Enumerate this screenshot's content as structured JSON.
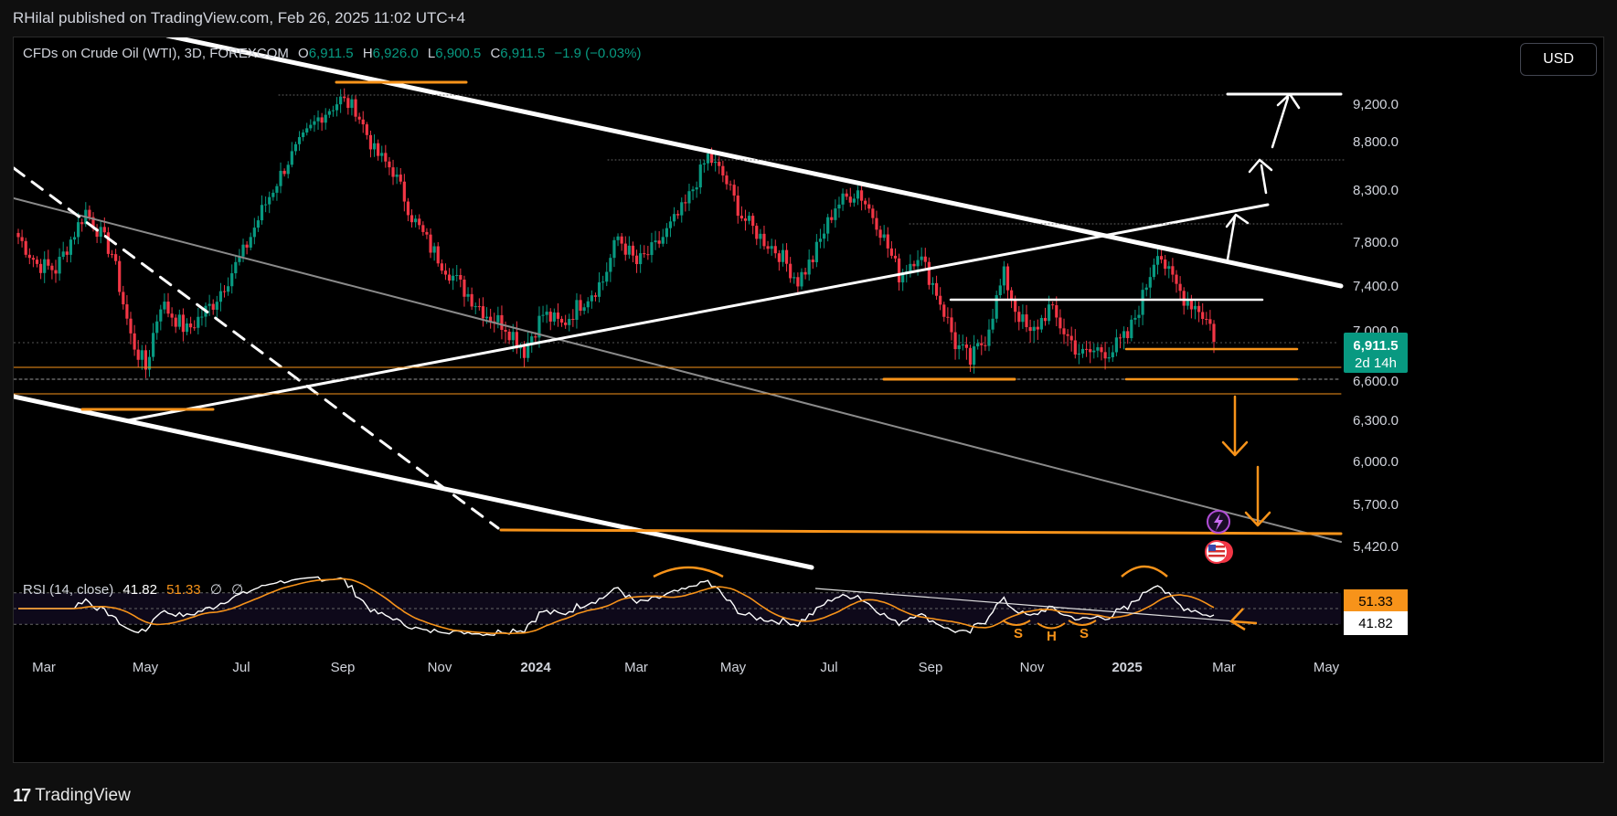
{
  "header": {
    "publish_line": "RHilal published on TradingView.com, Feb 26, 2025 11:02 UTC+4"
  },
  "footer": {
    "logo_mark": "17",
    "logo_text": "TradingView"
  },
  "toolbar": {
    "currency": "USD"
  },
  "legend": {
    "symbol": "CFDs on Crude Oil (WTI), 3D, FOREXCOM",
    "o_label": "O",
    "o_value": "6,911.5",
    "h_label": "H",
    "h_value": "6,926.0",
    "l_label": "L",
    "l_value": "6,900.5",
    "c_label": "C",
    "c_value": "6,911.5",
    "change": "−1.9 (−0.03%)"
  },
  "rsi_legend": {
    "name": "RSI (14, close)",
    "rsi_value": "41.82",
    "ma_value": "51.33",
    "extra1": "∅",
    "extra2": "∅"
  },
  "price_tag": {
    "value": "6,911.5",
    "countdown": "2d 14h"
  },
  "rsi_tags": {
    "ma": "51.33",
    "rsi": "41.82"
  },
  "pattern_labels": [
    "S",
    "H",
    "S"
  ],
  "colors": {
    "up": "#089981",
    "down": "#f23645",
    "orange": "#f7931a",
    "rsi_line": "#ffffff",
    "rsi_ma": "#f7931a",
    "accent_tag": "#089981"
  },
  "chart_data": {
    "type": "candlestick",
    "title": "CFDs on Crude Oil (WTI), 3D, FOREXCOM",
    "price_axis": {
      "ticks": [
        "9,200.0",
        "8,800.0",
        "8,300.0",
        "7,800.0",
        "7,400.0",
        "7,000.0",
        "6,600.0",
        "6,300.0",
        "6,000.0",
        "5,700.0",
        "5,420.0"
      ],
      "tick_values": [
        9200,
        8800,
        8300,
        7800,
        7400,
        7000,
        6600,
        6300,
        6000,
        5700,
        5420
      ]
    },
    "time_axis": {
      "labels": [
        "Mar",
        "May",
        "Jul",
        "Sep",
        "Nov",
        "2024",
        "Mar",
        "May",
        "Jul",
        "Sep",
        "Nov",
        "2025",
        "Mar",
        "May"
      ],
      "bold": [
        false,
        false,
        false,
        false,
        false,
        true,
        false,
        false,
        false,
        false,
        false,
        true,
        false,
        false
      ]
    },
    "close_anchors": [
      [
        0,
        7850
      ],
      [
        5,
        7600
      ],
      [
        10,
        7550
      ],
      [
        18,
        8100
      ],
      [
        25,
        7700
      ],
      [
        30,
        6950
      ],
      [
        34,
        6700
      ],
      [
        38,
        7250
      ],
      [
        45,
        7000
      ],
      [
        52,
        7250
      ],
      [
        60,
        7700
      ],
      [
        65,
        8100
      ],
      [
        72,
        8600
      ],
      [
        80,
        9050
      ],
      [
        86,
        9250
      ],
      [
        90,
        9150
      ],
      [
        95,
        8700
      ],
      [
        100,
        8500
      ],
      [
        105,
        8050
      ],
      [
        110,
        7750
      ],
      [
        118,
        7400
      ],
      [
        125,
        7150
      ],
      [
        130,
        7050
      ],
      [
        135,
        6850
      ],
      [
        140,
        7150
      ],
      [
        145,
        7050
      ],
      [
        150,
        7250
      ],
      [
        156,
        7450
      ],
      [
        160,
        7850
      ],
      [
        165,
        7600
      ],
      [
        170,
        7750
      ],
      [
        178,
        8150
      ],
      [
        184,
        8650
      ],
      [
        188,
        8450
      ],
      [
        193,
        8050
      ],
      [
        198,
        7850
      ],
      [
        203,
        7700
      ],
      [
        208,
        7450
      ],
      [
        212,
        7650
      ],
      [
        218,
        8150
      ],
      [
        224,
        8300
      ],
      [
        229,
        8000
      ],
      [
        235,
        7500
      ],
      [
        240,
        7700
      ],
      [
        245,
        7350
      ],
      [
        250,
        6900
      ],
      [
        254,
        6750
      ],
      [
        258,
        6950
      ],
      [
        263,
        7500
      ],
      [
        266,
        7200
      ],
      [
        270,
        6950
      ],
      [
        275,
        7200
      ],
      [
        280,
        6950
      ],
      [
        284,
        6800
      ],
      [
        288,
        6850
      ],
      [
        292,
        6850
      ],
      [
        296,
        6950
      ],
      [
        300,
        7300
      ],
      [
        304,
        7750
      ],
      [
        307,
        7500
      ],
      [
        311,
        7300
      ],
      [
        315,
        7200
      ],
      [
        318,
        7050
      ],
      [
        319,
        6911.5
      ]
    ],
    "n_candles": 320,
    "last_close": 6911.5,
    "rsi": {
      "length": 14,
      "source": "close",
      "last_rsi": 41.82,
      "last_ma": 51.33
    }
  }
}
